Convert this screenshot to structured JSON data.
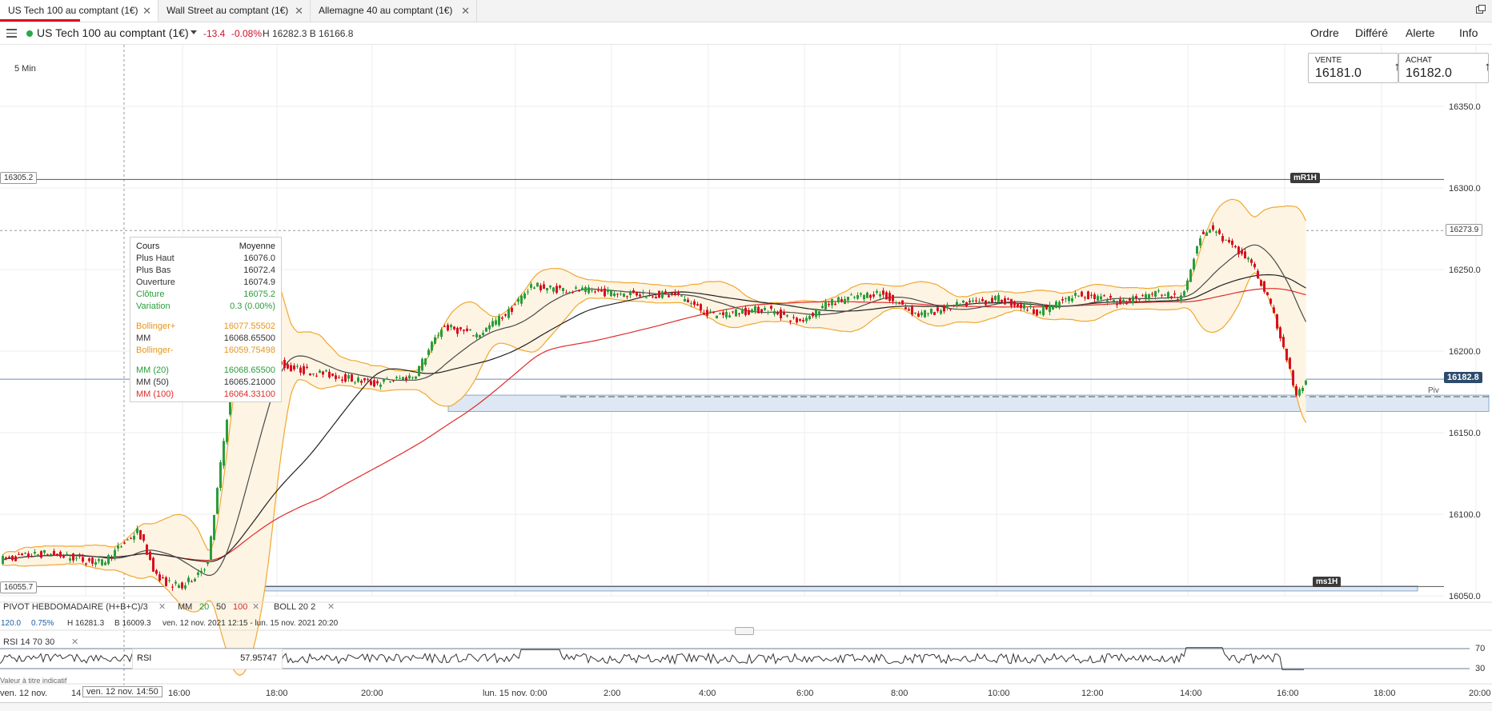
{
  "tabs": [
    {
      "label": "US Tech 100 au comptant (1€)",
      "active": true
    },
    {
      "label": "Wall Street au comptant (1€)",
      "active": false
    },
    {
      "label": "Allemagne 40 au comptant (1€)",
      "active": false
    }
  ],
  "header": {
    "market": "US Tech 100 au comptant (1€)",
    "change": "-13.4",
    "change_pct": "-0.08%",
    "hl": "H 16282.3 B 16166.8",
    "nav": [
      "Ordre",
      "Différé",
      "Alerte",
      "Info"
    ]
  },
  "timeframe": "5 Min",
  "prices": {
    "sell_label": "VENTE",
    "sell": "16181.0",
    "buy_label": "ACHAT",
    "buy": "16182.0"
  },
  "chart_data": {
    "type": "candlestick",
    "y_ticks": [
      "16350.0",
      "16300.0",
      "16250.0",
      "16200.0",
      "16150.0",
      "16100.0",
      "16050.0"
    ],
    "ylim": [
      16043,
      16389
    ],
    "x_ticks": [
      "16:00",
      "18:00",
      "20:00",
      "lun. 15 nov. 0:00",
      "2:00",
      "4:00",
      "6:00",
      "8:00",
      "10:00",
      "12:00",
      "14:00",
      "16:00",
      "18:00",
      "20:00"
    ],
    "left_labels": [
      "ven. 12 nov.",
      "14",
      "ven. 12 nov. 14:50"
    ],
    "levels": {
      "mR1H": 16305.2,
      "ms1H": 16055.7,
      "last": 16182.8,
      "dashed": 16273.9
    },
    "level_labels": {
      "left_top": "16305.2",
      "left_bottom": "16055.7",
      "mR1H": "mR1H",
      "ms1H": "ms1H",
      "last": "16182.8",
      "dashed": "16273.9",
      "piv": "Piv"
    },
    "zones": [
      {
        "from": 16163,
        "to": 16173
      },
      {
        "from": 16053,
        "to": 16056
      }
    ],
    "series_colors": {
      "up": "#2a9d3a",
      "down": "#d81020",
      "mm20": "#4a4a4a",
      "mm50": "#222222",
      "mm100": "#e02a2a",
      "boll": "#f0a830",
      "boll_fill": "#fdf4e3"
    }
  },
  "tooltip": {
    "head_k": "Cours",
    "head_v": "Moyenne",
    "rows": [
      {
        "k": "Plus Haut",
        "v": "16076.0",
        "c": "#333"
      },
      {
        "k": "Plus Bas",
        "v": "16072.4",
        "c": "#333"
      },
      {
        "k": "Ouverture",
        "v": "16074.9",
        "c": "#333"
      },
      {
        "k": "Clôture",
        "v": "16075.2",
        "c": "#2a9d3a"
      },
      {
        "k": "Variation",
        "v": "0.3 (0.00%)",
        "c": "#2a9d3a"
      },
      {
        "k": "Bollinger+",
        "v": "16077.55502",
        "c": "#e8951a"
      },
      {
        "k": "MM",
        "v": "16068.65500",
        "c": "#333"
      },
      {
        "k": "Bollinger-",
        "v": "16059.75498",
        "c": "#e8951a"
      },
      {
        "k": "MM (20)",
        "v": "16068.65500",
        "c": "#2a9d3a"
      },
      {
        "k": "MM (50)",
        "v": "16065.21000",
        "c": "#333"
      },
      {
        "k": "MM (100)",
        "v": "16064.33100",
        "c": "#e02a2a"
      }
    ]
  },
  "indicators": {
    "pivot": "PIVOT  HEBDOMADAIRE  (H+B+C)/3",
    "pivot_vals": {
      "a": "120.0",
      "b": "0.75%",
      "h": "H 16281.3",
      "l": "B 16009.3"
    },
    "mm": "MM",
    "mm_20": "20",
    "mm_50": "50",
    "mm_100": "100",
    "boll": "BOLL  20  2",
    "range": "ven. 12 nov. 2021 12:15 - lun. 15 nov. 2021 20:20",
    "rsi": "RSI  14  70  30",
    "rsi_label": "RSI",
    "rsi_value": "57.95747",
    "rsi_70": "70",
    "rsi_30": "30",
    "note": "Valeur à titre indicatif"
  }
}
